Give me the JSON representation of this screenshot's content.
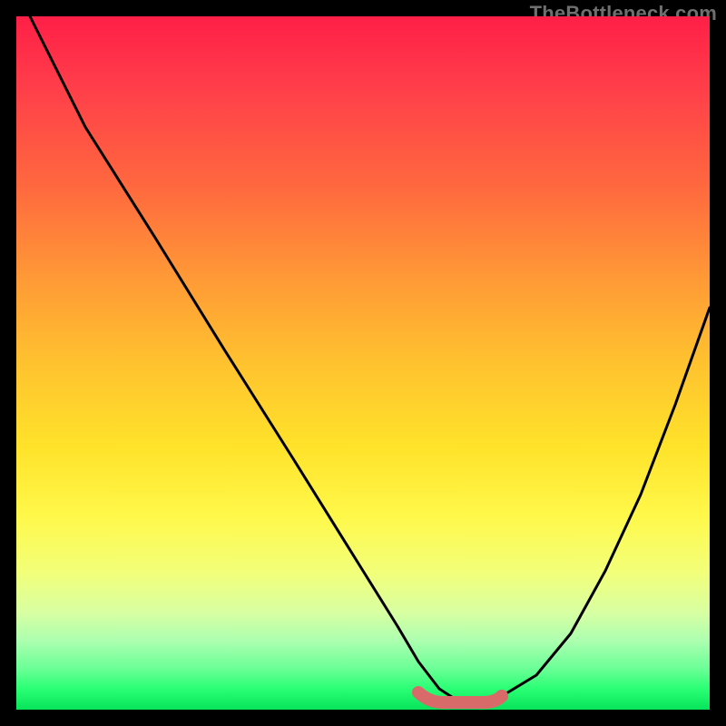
{
  "watermark": "TheBottleneck.com",
  "chart_data": {
    "type": "line",
    "title": "",
    "xlabel": "",
    "ylabel": "",
    "xlim": [
      0,
      100
    ],
    "ylim": [
      0,
      100
    ],
    "series": [
      {
        "name": "bottleneck-curve",
        "x": [
          2,
          10,
          20,
          30,
          40,
          50,
          55,
          58,
          61,
          64,
          67,
          70,
          75,
          80,
          85,
          90,
          95,
          100
        ],
        "values": [
          100,
          84,
          68,
          52,
          36,
          20,
          12,
          7,
          3,
          1,
          1,
          2,
          5,
          11,
          20,
          31,
          44,
          58
        ]
      },
      {
        "name": "optimal-band",
        "x": [
          58,
          61,
          64,
          67,
          70
        ],
        "values": [
          3,
          1,
          1,
          1,
          2
        ]
      }
    ],
    "colors": {
      "curve": "#000000",
      "optimal_band": "#d86a6a"
    }
  }
}
